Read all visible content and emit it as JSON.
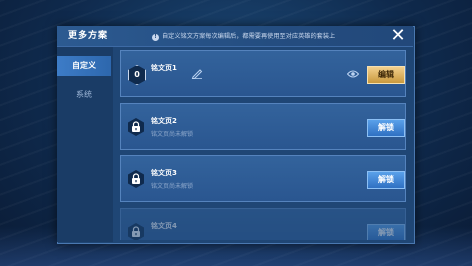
{
  "dialog": {
    "title": "更多方案",
    "notice": "自定义铭文方案每次编辑后，都需要再使用至对应英雄的套装上",
    "close_icon": "close-icon"
  },
  "sidebar": {
    "tabs": [
      {
        "label": "自定义",
        "active": true
      },
      {
        "label": "系统",
        "active": false
      }
    ]
  },
  "pages": [
    {
      "name": "铭文页1",
      "number": "0",
      "subtitle": "",
      "locked": false,
      "button": "编辑"
    },
    {
      "name": "铭文页2",
      "number": "",
      "subtitle": "铭文页尚未解锁",
      "locked": true,
      "button": "解锁"
    },
    {
      "name": "铭文页3",
      "number": "",
      "subtitle": "铭文页尚未解锁",
      "locked": true,
      "button": "解锁"
    },
    {
      "name": "铭文页4",
      "number": "",
      "subtitle": "",
      "locked": true,
      "button": "解锁"
    }
  ],
  "colors": {
    "edit_button": "#c9993e",
    "unlock_button": "#2f70c2",
    "panel": "#1f4675"
  }
}
